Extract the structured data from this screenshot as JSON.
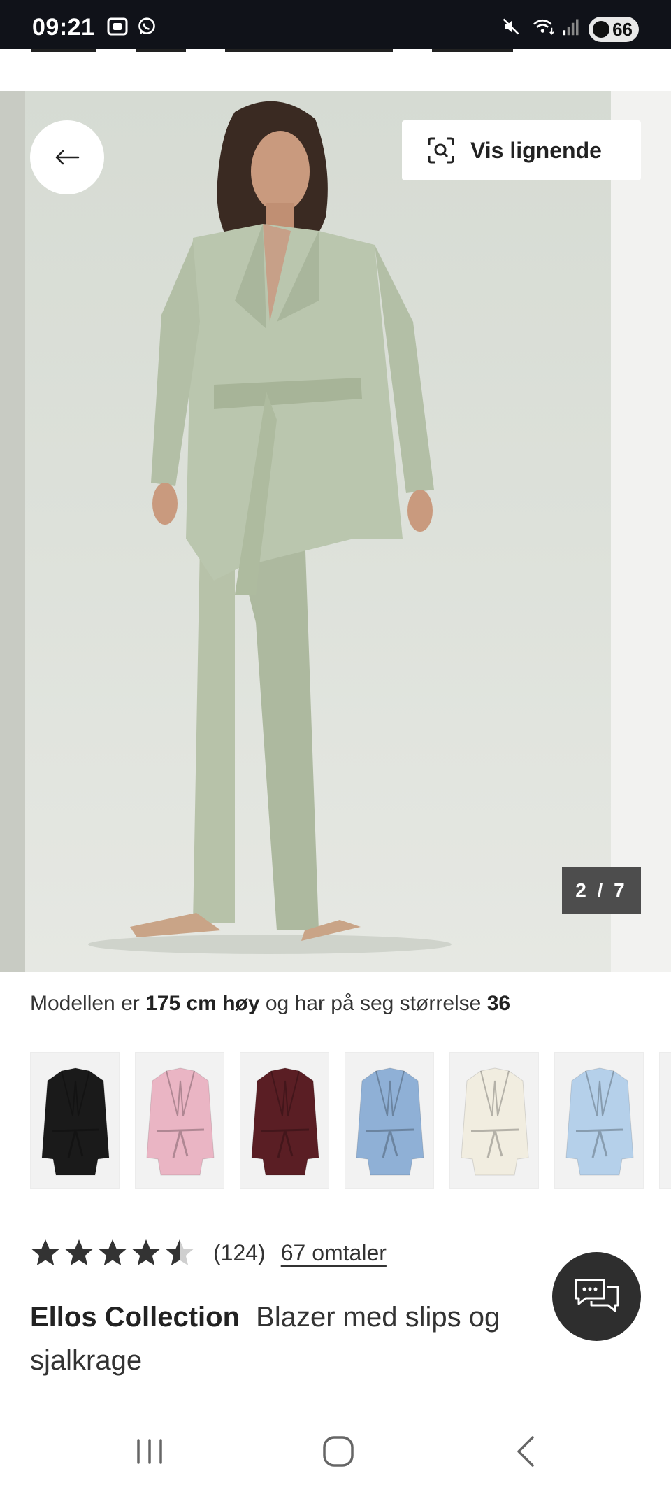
{
  "status_bar": {
    "time": "09:21",
    "battery": "66",
    "icons": [
      "screenshot-icon",
      "whatsapp-icon",
      "mute-icon",
      "wifi-icon",
      "signal-icon",
      "battery-icon"
    ]
  },
  "gallery": {
    "back_icon": "arrow-left-icon",
    "similar_button_label": "Vis lignende",
    "similar_icon": "visual-search-icon",
    "pager_text": "2 / 7",
    "image_description_colors": {
      "suit": "#b9c4ad",
      "background": "#dde1da"
    }
  },
  "model_info": {
    "prefix": "Modellen er",
    "height": "175 cm høy",
    "middle": "og har på seg størrelse",
    "size": "36"
  },
  "swatches": [
    {
      "name": "black",
      "color": "#1a1a1a"
    },
    {
      "name": "pink",
      "color": "#eab5c4"
    },
    {
      "name": "burgundy",
      "color": "#5a1e24"
    },
    {
      "name": "blue",
      "color": "#8fb0d6"
    },
    {
      "name": "cream",
      "color": "#f1ede0"
    },
    {
      "name": "light-blue",
      "color": "#b5d0ea"
    }
  ],
  "rating": {
    "stars_value": 4.5,
    "count": "(124)",
    "reviews_label": "67 omtaler"
  },
  "product": {
    "brand": "Ellos Collection",
    "name": "Blazer med slips og sjalkrage"
  },
  "chat_icon": "chat-bubbles-icon",
  "android_nav": [
    "recents-icon",
    "home-icon",
    "back-icon"
  ]
}
